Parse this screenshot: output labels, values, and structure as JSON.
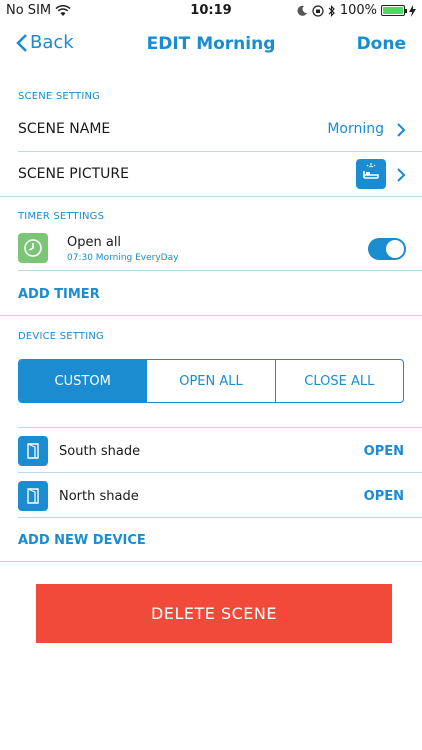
{
  "status_bar": {
    "carrier": "No SIM",
    "time": "10:19",
    "battery": "100%"
  },
  "nav": {
    "back_label": "Back",
    "title": "EDIT Morning",
    "done_label": "Done"
  },
  "scene_setting": {
    "header": "SCENE SETTING",
    "name_label": "SCENE NAME",
    "name_value": "Morning",
    "picture_label": "SCENE PICTURE"
  },
  "timer_settings": {
    "header": "TIMER SETTINGS",
    "timer_title": "Open all",
    "timer_detail": "07:30 Morning EveryDay",
    "timer_enabled": true,
    "add_timer": "ADD TIMER"
  },
  "device_setting": {
    "header": "DEVICE SETTING",
    "segments": [
      "CUSTOM",
      "OPEN ALL",
      "CLOSE ALL"
    ],
    "selected_segment": "CUSTOM",
    "devices": [
      {
        "name": "South shade",
        "action": "OPEN"
      },
      {
        "name": "North shade",
        "action": "OPEN"
      }
    ],
    "add_device": "ADD NEW DEVICE"
  },
  "delete_label": "DELETE SCENE",
  "colors": {
    "accent": "#1a8ccf",
    "danger": "#f14a3b",
    "timer_icon": "#7cc576"
  }
}
